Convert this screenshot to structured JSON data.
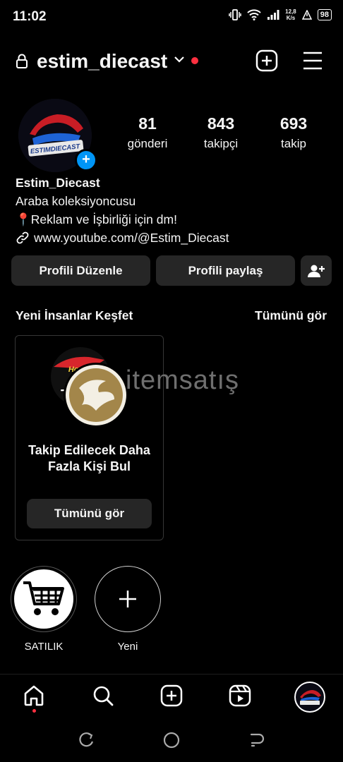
{
  "status": {
    "time": "11:02",
    "speed": "12,8",
    "speed_unit": "K/s",
    "battery": "98"
  },
  "profile": {
    "username": "estim_diecast",
    "avatar_text": "ESTIMDIECAST",
    "stats": [
      {
        "value": "81",
        "label": "gönderi"
      },
      {
        "value": "843",
        "label": "takipçi"
      },
      {
        "value": "693",
        "label": "takip"
      }
    ],
    "name": "Estim_Diecast",
    "bio_line1": "Araba koleksiyoncusu",
    "bio_line2": "Reklam ve İşbirliği için dm!",
    "link": "www.youtube.com/@Estim_Diecast"
  },
  "buttons": {
    "edit": "Profili Düzenle",
    "share": "Profili paylaş"
  },
  "discover": {
    "title": "Yeni İnsanlar Keşfet",
    "see_all": "Tümünü gör",
    "card_title": "Takip Edilecek Daha Fazla Kişi Bul",
    "card_button": "Tümünü gör"
  },
  "watermark": "itemsatış",
  "highlights": [
    {
      "label": "SATILIK"
    },
    {
      "label": "Yeni"
    }
  ],
  "colors": {
    "background": "#000000",
    "button": "#262626",
    "accent_blue": "#0095f6",
    "notification_red": "#ff3040"
  }
}
